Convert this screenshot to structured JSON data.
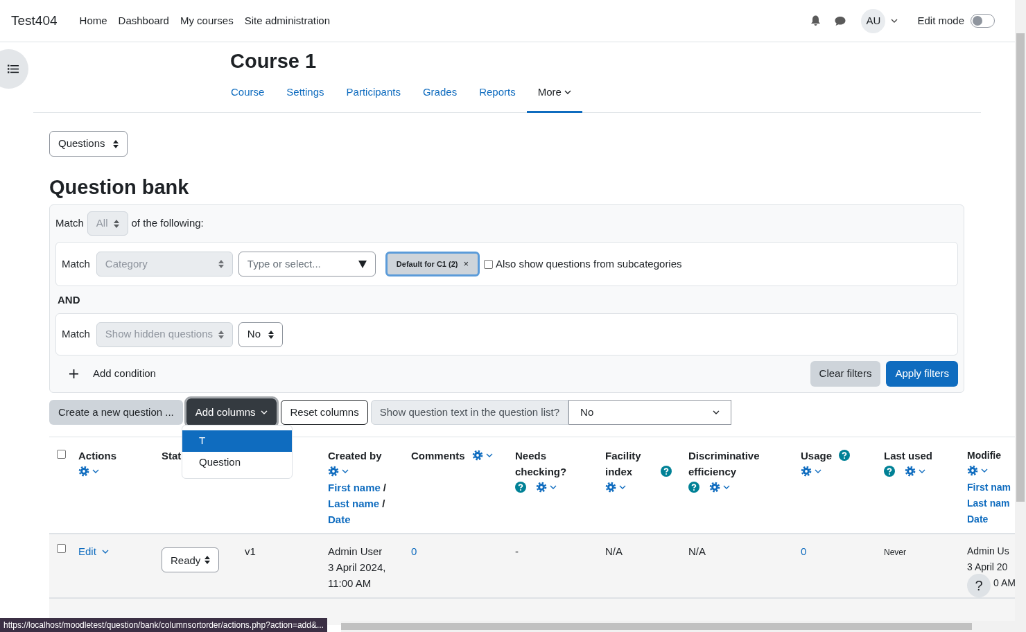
{
  "site_name": "Test404",
  "primary_nav": [
    {
      "label": "Home"
    },
    {
      "label": "Dashboard"
    },
    {
      "label": "My courses"
    },
    {
      "label": "Site administration"
    }
  ],
  "user": {
    "initials": "AU"
  },
  "edit_mode": {
    "label": "Edit mode",
    "on": false
  },
  "course_title": "Course 1",
  "secondary_nav": [
    {
      "label": "Course",
      "selected": false
    },
    {
      "label": "Settings",
      "selected": false
    },
    {
      "label": "Participants",
      "selected": false
    },
    {
      "label": "Grades",
      "selected": false
    },
    {
      "label": "Reports",
      "selected": false
    },
    {
      "label": "More",
      "selected": true
    }
  ],
  "page_select": "Questions",
  "heading": "Question bank",
  "filters": {
    "match_label": "Match",
    "match_value": "All",
    "suffix": "of the following:",
    "conditions": [
      {
        "kind": "category",
        "match_label": "Match",
        "field": "Category",
        "search_placeholder": "Type or select...",
        "chip": "Default for C1 (2)",
        "chip_remove": "×",
        "subcategories": {
          "label": "Also show questions from subcategories",
          "checked": false
        }
      },
      {
        "kind": "select",
        "match_label": "Match",
        "field": "Show hidden questions",
        "value": "No"
      }
    ],
    "joiner": "AND",
    "add_condition": "Add condition",
    "clear": "Clear filters",
    "apply": "Apply filters"
  },
  "toolbar": {
    "create": "Create a new question ...",
    "add_columns": "Add columns",
    "reset": "Reset columns",
    "show_text_label": "Show question text in the question list?",
    "show_text_value": "No"
  },
  "add_columns_menu": [
    {
      "label": "T",
      "selected": true
    },
    {
      "label": "Question",
      "selected": false
    }
  ],
  "table": {
    "select_all": {
      "checked": false
    },
    "columns": [
      {
        "title": "Actions",
        "settings": true
      },
      {
        "title": "Stat"
      },
      {},
      {
        "title": "Created by",
        "settings": true,
        "sort_links": [
          {
            "label": "First name",
            "sep": "/"
          },
          {
            "label": "Last name",
            "sep": "/"
          },
          {
            "label": "Date"
          }
        ]
      },
      {
        "title": "Comments",
        "settings": true
      },
      {
        "title": "Needs checking?",
        "help": true,
        "settings": true
      },
      {
        "title": "Facility index",
        "help": true,
        "settings": true
      },
      {
        "title": "Discriminative efficiency",
        "help": true,
        "settings": true
      },
      {
        "title": "Usage",
        "help": true,
        "settings": true
      },
      {
        "title": "Last used",
        "help": true,
        "settings": true
      },
      {
        "title": "Modifie",
        "settings": true,
        "sort_links": [
          {
            "label": "First nam"
          },
          {
            "label": "Last nam"
          },
          {
            "label": "Date"
          }
        ]
      }
    ],
    "rows": [
      {
        "checked": false,
        "cells": [
          {
            "kind": "actions",
            "text": "Edit"
          },
          {
            "kind": "select",
            "text": "Ready"
          },
          {
            "kind": "text",
            "lines": [
              "v1"
            ]
          },
          {
            "kind": "text",
            "lines": [
              "Admin User",
              "3 April 2024,",
              "11:00 AM"
            ]
          },
          {
            "kind": "link",
            "text": "0"
          },
          {
            "kind": "text",
            "lines": [
              "-"
            ]
          },
          {
            "kind": "text",
            "lines": [
              "N/A"
            ]
          },
          {
            "kind": "text",
            "lines": [
              "N/A"
            ]
          },
          {
            "kind": "link",
            "text": "0"
          },
          {
            "kind": "small",
            "text": "Never"
          },
          {
            "kind": "text",
            "lines": [
              "Admin Us",
              "3 April 20",
              "0 AM"
            ]
          }
        ]
      }
    ]
  },
  "help_button": "?",
  "status_bar": "https://localhost/moodletest/question/bank/columnsortorder/actions.php?action=add&..."
}
